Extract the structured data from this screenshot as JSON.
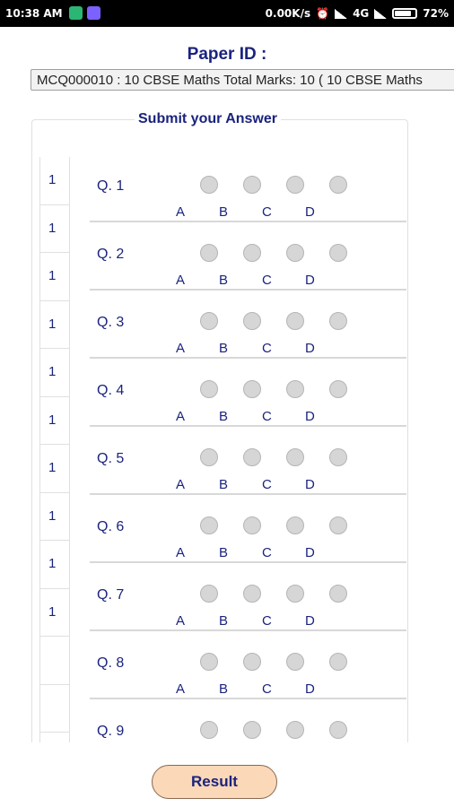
{
  "status_bar": {
    "time": "10:38 AM",
    "speed": "0.00K/s",
    "network": "4G",
    "battery": "72%"
  },
  "header": {
    "title": "Paper ID :",
    "selected_paper": "MCQ000010 : 10 CBSE Maths Total Marks: 10 ( 10 CBSE Maths"
  },
  "section": {
    "legend": "Submit your Answer"
  },
  "marks": [
    "1",
    "1",
    "1",
    "1",
    "1",
    "1",
    "1",
    "1",
    "1",
    "1",
    "",
    ""
  ],
  "questions": [
    {
      "label": "Q. 1",
      "options": [
        "A",
        "B",
        "C",
        "D"
      ]
    },
    {
      "label": "Q. 2",
      "options": [
        "A",
        "B",
        "C",
        "D"
      ]
    },
    {
      "label": "Q. 3",
      "options": [
        "A",
        "B",
        "C",
        "D"
      ]
    },
    {
      "label": "Q. 4",
      "options": [
        "A",
        "B",
        "C",
        "D"
      ]
    },
    {
      "label": "Q. 5",
      "options": [
        "A",
        "B",
        "C",
        "D"
      ]
    },
    {
      "label": "Q. 6",
      "options": [
        "A",
        "B",
        "C",
        "D"
      ]
    },
    {
      "label": "Q. 7",
      "options": [
        "A",
        "B",
        "C",
        "D"
      ]
    },
    {
      "label": "Q. 8",
      "options": [
        "A",
        "B",
        "C",
        "D"
      ]
    },
    {
      "label": "Q. 9",
      "options": [
        "",
        "",
        "",
        ""
      ]
    }
  ],
  "result_button": "Result"
}
